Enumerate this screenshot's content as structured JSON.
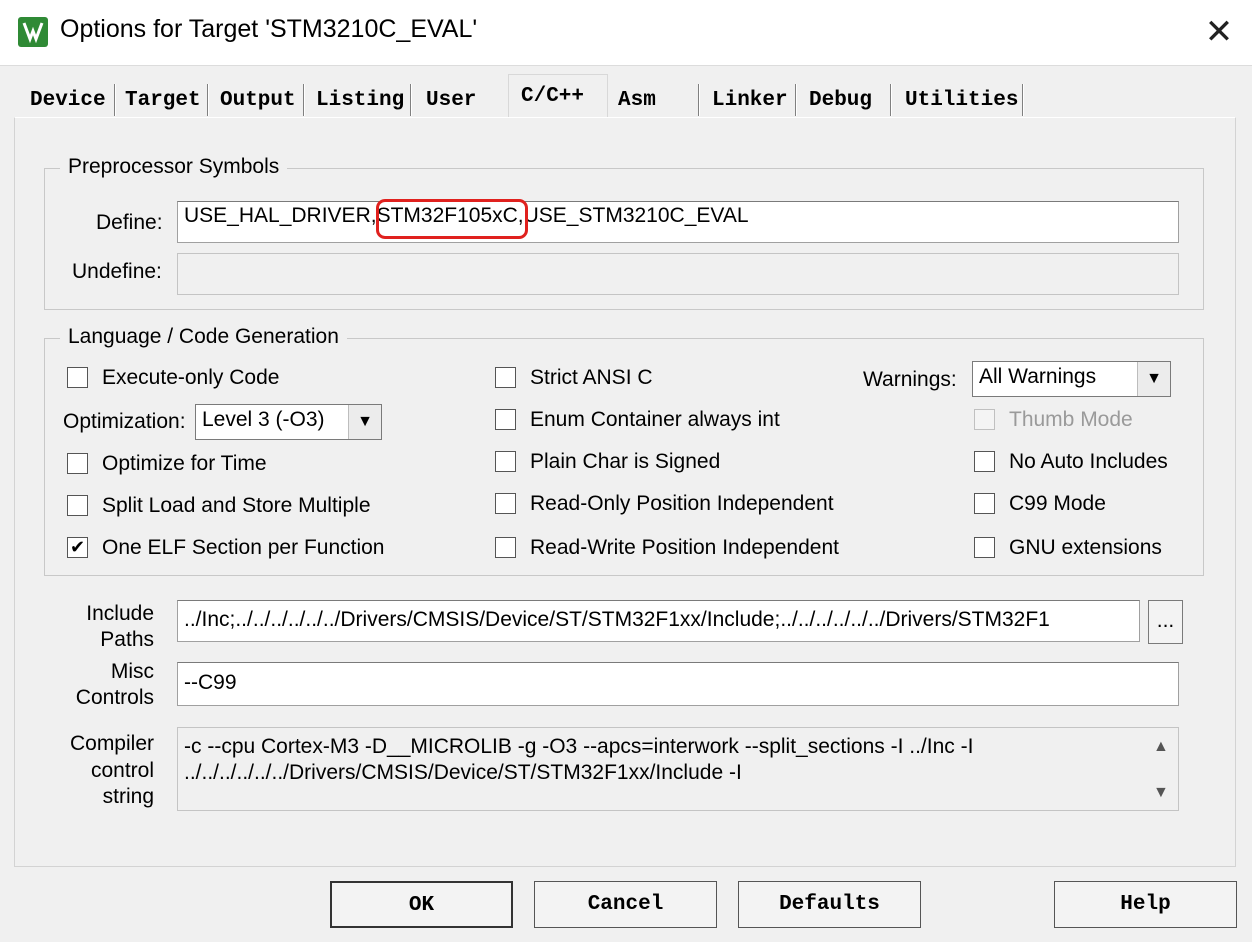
{
  "window": {
    "title": "Options for Target 'STM3210C_EVAL'",
    "close_symbol": "✕"
  },
  "tabs": [
    "Device",
    "Target",
    "Output",
    "Listing",
    "User",
    "C/C++",
    "Asm",
    "Linker",
    "Debug",
    "Utilities"
  ],
  "active_tab": "C/C++",
  "preprocessor": {
    "legend": "Preprocessor Symbols",
    "define_label": "Define:",
    "define_before": "USE_HAL_DRIVER,",
    "define_highlight": "STM32F105xC",
    "define_after": ",USE_STM3210C_EVAL",
    "undefine_label": "Undefine:",
    "undefine_value": ""
  },
  "language": {
    "legend": "Language / Code Generation",
    "execute_only": {
      "label": "Execute-only Code",
      "checked": false
    },
    "optimization_label": "Optimization:",
    "optimization_value": "Level 3 (-O3)",
    "optimize_time": {
      "label": "Optimize for Time",
      "checked": false
    },
    "split_load": {
      "label": "Split Load and Store Multiple",
      "checked": false
    },
    "one_elf": {
      "label": "One ELF Section per Function",
      "checked": true,
      "mark": "✔"
    },
    "strict_ansi": {
      "label": "Strict ANSI C",
      "checked": false
    },
    "enum_container": {
      "label": "Enum Container always int",
      "checked": false
    },
    "plain_char": {
      "label": "Plain Char is Signed",
      "checked": false
    },
    "ro_pi": {
      "label": "Read-Only Position Independent",
      "checked": false
    },
    "rw_pi": {
      "label": "Read-Write Position Independent",
      "checked": false
    },
    "warnings_label": "Warnings:",
    "warnings_value": "All Warnings",
    "thumb_mode": {
      "label": "Thumb Mode",
      "checked": false,
      "disabled": true
    },
    "no_auto_includes": {
      "label": "No Auto Includes",
      "checked": false
    },
    "c99_mode": {
      "label": "C99 Mode",
      "checked": false
    },
    "gnu_ext": {
      "label": "GNU extensions",
      "checked": false
    }
  },
  "include_paths": {
    "label_line1": "Include",
    "label_line2": "Paths",
    "value": "../Inc;../../../../../../Drivers/CMSIS/Device/ST/STM32F1xx/Include;../../../../../../Drivers/STM32F1",
    "browse_label": "..."
  },
  "misc_controls": {
    "label_line1": "Misc",
    "label_line2": "Controls",
    "value": "--C99"
  },
  "compiler_control": {
    "label_line1": "Compiler",
    "label_line2": "control",
    "label_line3": "string",
    "line1": "-c --cpu Cortex-M3 -D__MICROLIB -g -O3 --apcs=interwork --split_sections -I ../Inc -I",
    "line2": "../../../../../../Drivers/CMSIS/Device/ST/STM32F1xx/Include -I"
  },
  "buttons": {
    "ok": "OK",
    "cancel": "Cancel",
    "defaults": "Defaults",
    "help": "Help"
  },
  "colors": {
    "highlight": "#e0211e",
    "app_icon": "#2f8a35"
  }
}
